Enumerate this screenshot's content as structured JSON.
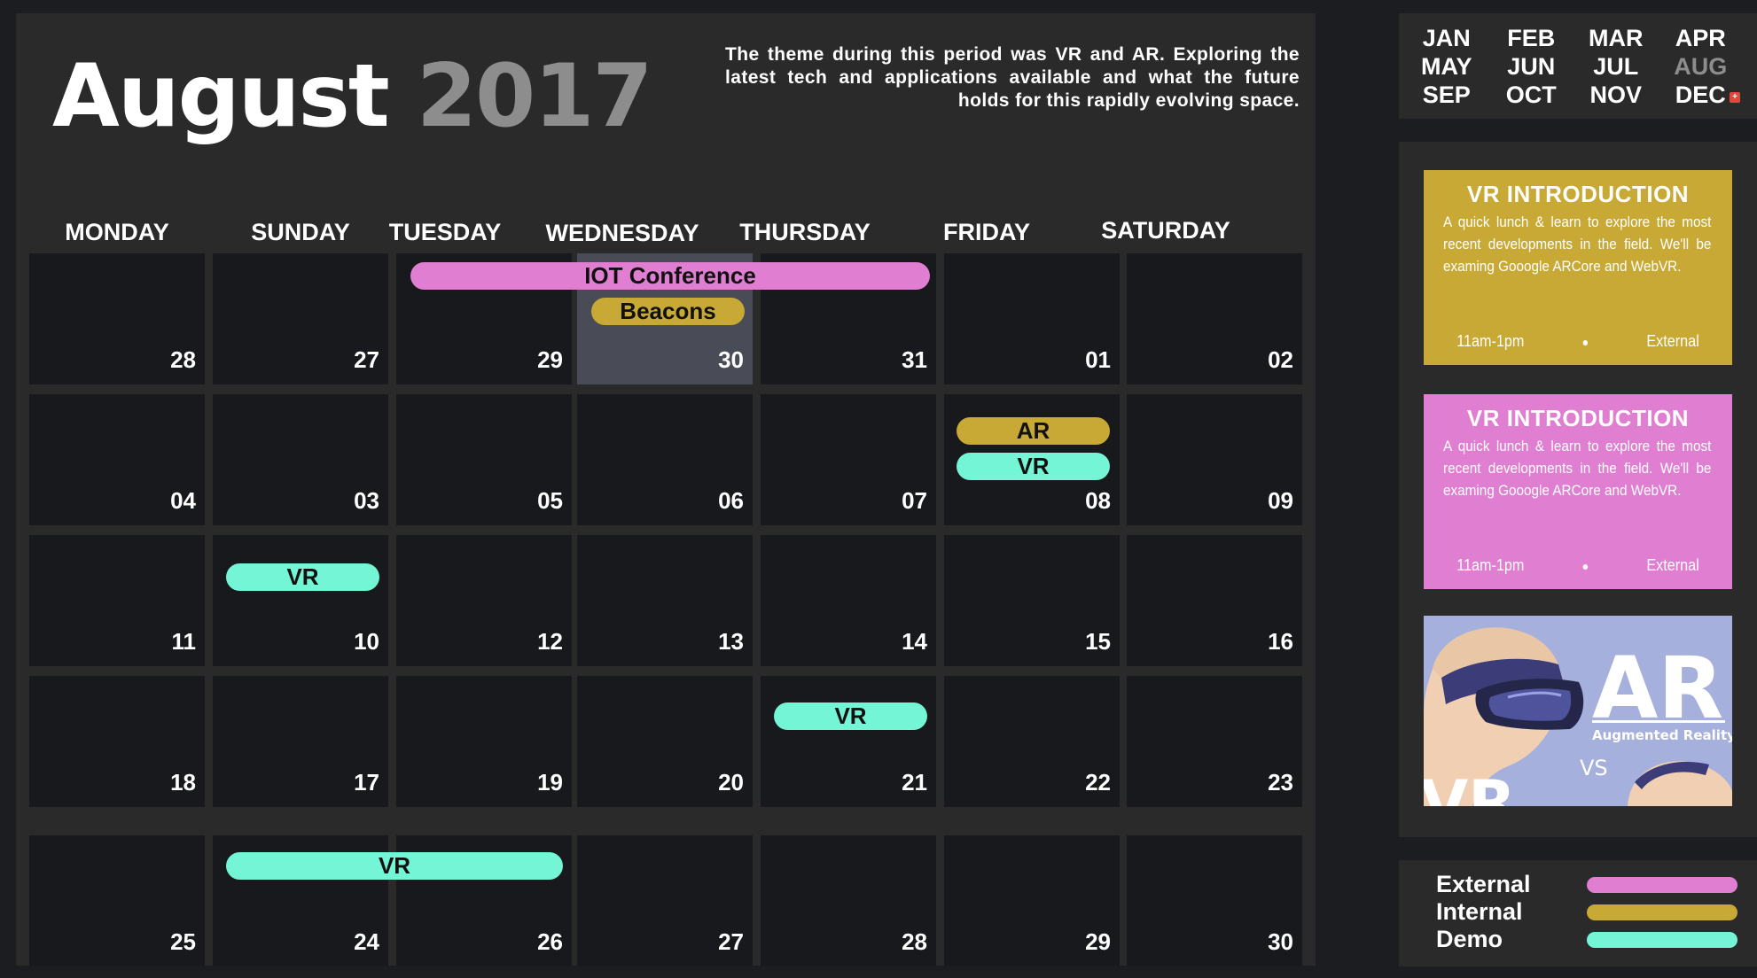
{
  "header": {
    "month": "August",
    "year": "2017",
    "description": "The theme during this period was VR and AR. Exploring the latest tech and applications available and what the future holds for this rapidly evolving space."
  },
  "day_names": [
    "MONDAY",
    "SUNDAY",
    "TUESDAY",
    "WEDNESDAY",
    "THURSDAY",
    "FRIDAY",
    "SATURDAY"
  ],
  "weeks": [
    [
      "28",
      "27",
      "29",
      "30",
      "31",
      "01",
      "02"
    ],
    [
      "04",
      "03",
      "05",
      "06",
      "07",
      "08",
      "09"
    ],
    [
      "11",
      "10",
      "12",
      "13",
      "14",
      "15",
      "16"
    ],
    [
      "18",
      "17",
      "19",
      "20",
      "21",
      "22",
      "23"
    ],
    [
      "25",
      "24",
      "26",
      "27",
      "28",
      "29",
      "30"
    ]
  ],
  "highlighted_day": "30",
  "events": [
    {
      "label": "IOT Conference",
      "type": "External",
      "color": "#e07fd2"
    },
    {
      "label": "Beacons",
      "type": "Internal",
      "color": "#c8a935"
    },
    {
      "label": "AR",
      "type": "Internal",
      "color": "#c8a935"
    },
    {
      "label": "VR",
      "type": "Demo",
      "color": "#74f5d6"
    },
    {
      "label": "VR",
      "type": "Demo",
      "color": "#74f5d6"
    },
    {
      "label": "VR",
      "type": "Demo",
      "color": "#74f5d6"
    },
    {
      "label": "VR",
      "type": "Demo",
      "color": "#74f5d6"
    }
  ],
  "months": [
    "JAN",
    "FEB",
    "MAR",
    "APR",
    "MAY",
    "JUN",
    "JUL",
    "AUG",
    "SEP",
    "OCT",
    "NOV",
    "DEC"
  ],
  "current_month": "AUG",
  "cards": [
    {
      "title": "VR INTRODUCTION",
      "body": "A quick lunch & learn to explore the most recent developments in the field. We'll be examing Gooogle ARCore and WebVR.",
      "time": "11am-1pm",
      "type": "External",
      "color": "#c8a935"
    },
    {
      "title": "VR INTRODUCTION",
      "body": "A quick lunch & learn to explore the most recent developments in the field. We'll be examing Gooogle ARCore and WebVR.",
      "time": "11am-1pm",
      "type": "External",
      "color": "#e07fd2"
    }
  ],
  "promo_image": {
    "big_text": "AR",
    "caption": "Augmented Reality",
    "vs": "VS",
    "icon": "vr-headset-illustration"
  },
  "legend": [
    {
      "label": "External",
      "color": "#e07fd2"
    },
    {
      "label": "Internal",
      "color": "#c8a935"
    },
    {
      "label": "Demo",
      "color": "#74f5d6"
    }
  ],
  "colors": {
    "background": "#1c1d20",
    "panel": "#2a2a2a",
    "cell": "#18191c",
    "highlight": "#494b56",
    "external": "#e07fd2",
    "internal": "#c8a935",
    "demo": "#74f5d6"
  }
}
